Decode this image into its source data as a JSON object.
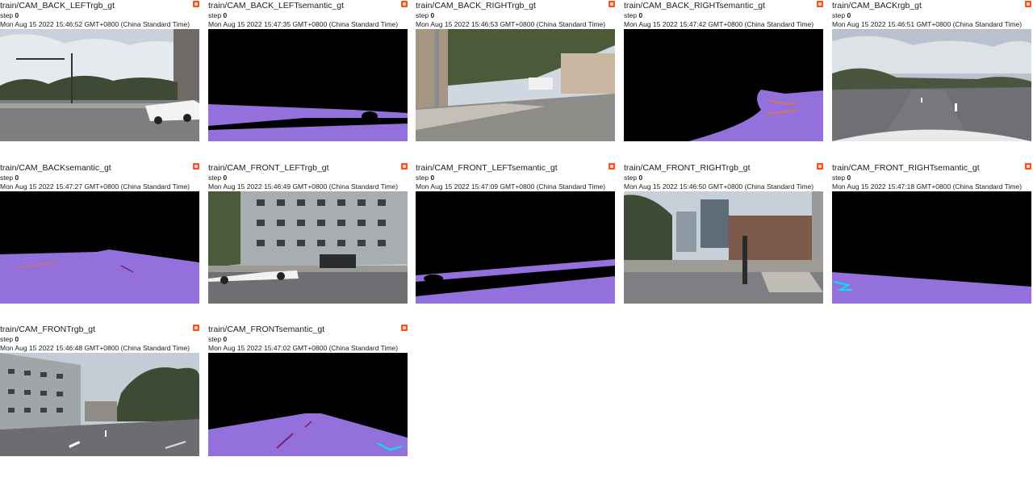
{
  "cards": [
    {
      "tag": "train/CAM_BACK_LEFTrgb_gt",
      "step_label": "step",
      "step": "0",
      "timestamp": "Mon Aug 15 2022 15:46:52 GMT+0800 (China Standard Time)"
    },
    {
      "tag": "train/CAM_BACK_LEFTsemantic_gt",
      "step_label": "step",
      "step": "0",
      "timestamp": "Mon Aug 15 2022 15:47:35 GMT+0800 (China Standard Time)"
    },
    {
      "tag": "train/CAM_BACK_RIGHTrgb_gt",
      "step_label": "step",
      "step": "0",
      "timestamp": "Mon Aug 15 2022 15:46:53 GMT+0800 (China Standard Time)"
    },
    {
      "tag": "train/CAM_BACK_RIGHTsemantic_gt",
      "step_label": "step",
      "step": "0",
      "timestamp": "Mon Aug 15 2022 15:47:42 GMT+0800 (China Standard Time)"
    },
    {
      "tag": "train/CAM_BACKrgb_gt",
      "step_label": "step",
      "step": "0",
      "timestamp": "Mon Aug 15 2022 15:46:51 GMT+0800 (China Standard Time)"
    },
    {
      "tag": "train/CAM_BACKsemantic_gt",
      "step_label": "step",
      "step": "0",
      "timestamp": "Mon Aug 15 2022 15:47:27 GMT+0800 (China Standard Time)"
    },
    {
      "tag": "train/CAM_FRONT_LEFTrgb_gt",
      "step_label": "step",
      "step": "0",
      "timestamp": "Mon Aug 15 2022 15:46:49 GMT+0800 (China Standard Time)"
    },
    {
      "tag": "train/CAM_FRONT_LEFTsemantic_gt",
      "step_label": "step",
      "step": "0",
      "timestamp": "Mon Aug 15 2022 15:47:09 GMT+0800 (China Standard Time)"
    },
    {
      "tag": "train/CAM_FRONT_RIGHTrgb_gt",
      "step_label": "step",
      "step": "0",
      "timestamp": "Mon Aug 15 2022 15:46:50 GMT+0800 (China Standard Time)"
    },
    {
      "tag": "train/CAM_FRONT_RIGHTsemantic_gt",
      "step_label": "step",
      "step": "0",
      "timestamp": "Mon Aug 15 2022 15:47:18 GMT+0800 (China Standard Time)"
    },
    {
      "tag": "train/CAM_FRONTrgb_gt",
      "step_label": "step",
      "step": "0",
      "timestamp": "Mon Aug 15 2022 15:46:48 GMT+0800 (China Standard Time)"
    },
    {
      "tag": "train/CAM_FRONTsemantic_gt",
      "step_label": "step",
      "step": "0",
      "timestamp": "Mon Aug 15 2022 15:47:02 GMT+0800 (China Standard Time)"
    }
  ],
  "colors": {
    "pin": "#f4511e",
    "semantic_road": "#9370db",
    "semantic_marking": "#e07a3a",
    "semantic_lane": "#00e5ee",
    "sky": "#b8c4cf"
  },
  "icons": {
    "pin": "pin-icon"
  }
}
